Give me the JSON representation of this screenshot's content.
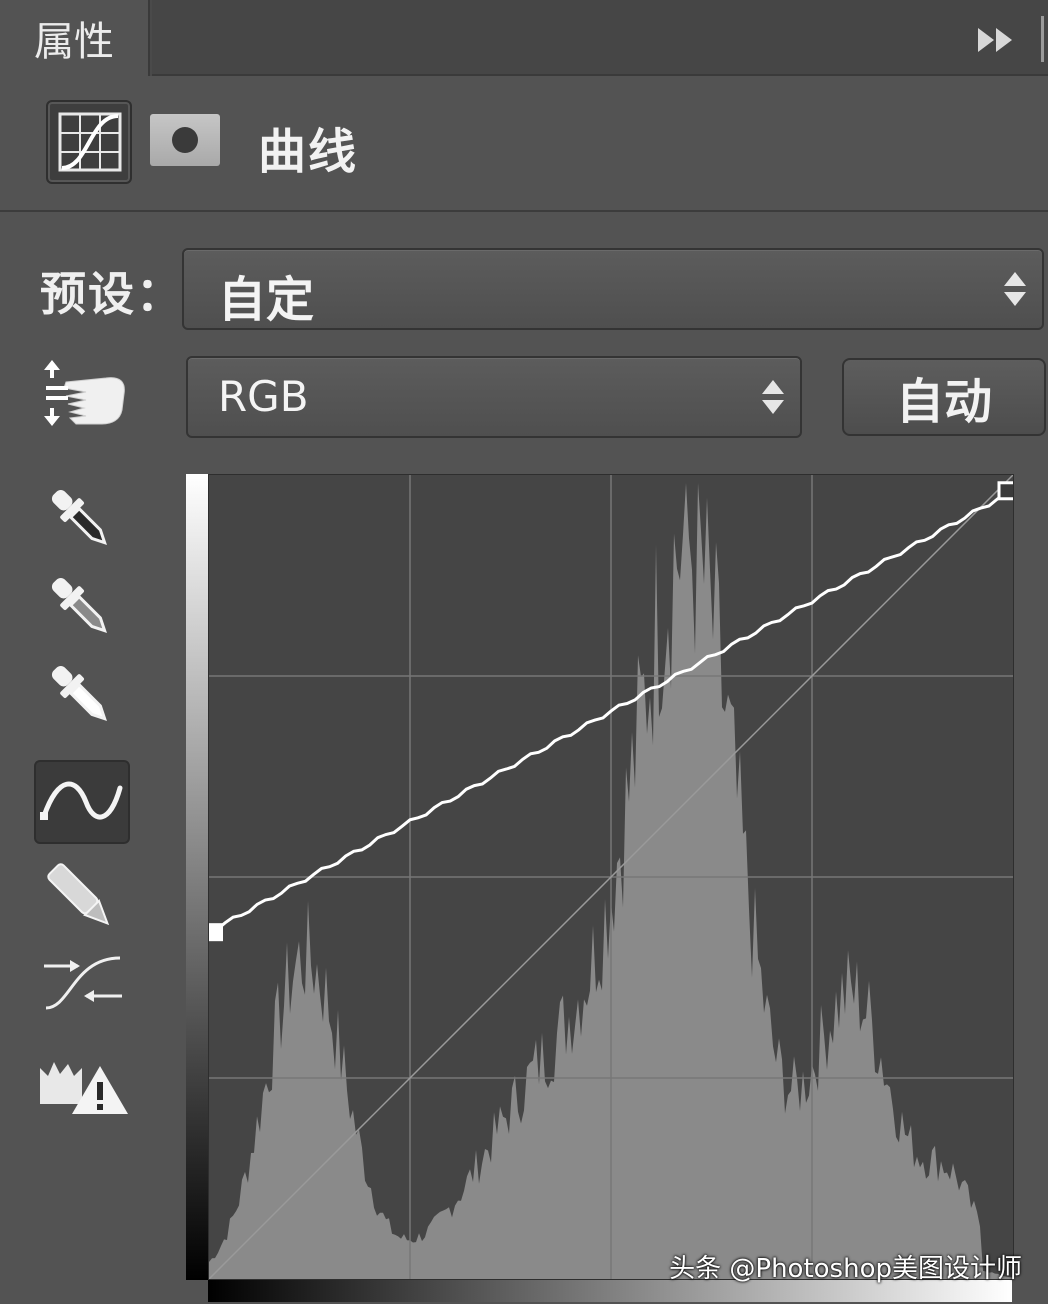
{
  "panel": {
    "tab_title": "属性",
    "title": "曲线",
    "preset_label": "预设：",
    "preset_value": "自定",
    "channel_value": "RGB",
    "auto_label": "自动"
  },
  "tools": [
    {
      "name": "on-image-adjust-icon"
    },
    {
      "name": "black-point-eyedropper-icon"
    },
    {
      "name": "gray-point-eyedropper-icon"
    },
    {
      "name": "white-point-eyedropper-icon"
    },
    {
      "name": "edit-curve-points-icon",
      "active": true
    },
    {
      "name": "pencil-draw-icon"
    },
    {
      "name": "smooth-curve-icon"
    },
    {
      "name": "clipping-warning-icon"
    }
  ],
  "curve": {
    "points": [
      [
        0,
        110
      ],
      [
        255,
        250
      ]
    ],
    "histogram_shape": "mid-tone peak with left shoulder"
  },
  "watermark": "头条 @Photoshop美图设计师",
  "colors": {
    "panel_bg": "#535353",
    "graph_bg": "#454545",
    "curve": "#ffffff",
    "histogram": "#8a8a8a"
  }
}
